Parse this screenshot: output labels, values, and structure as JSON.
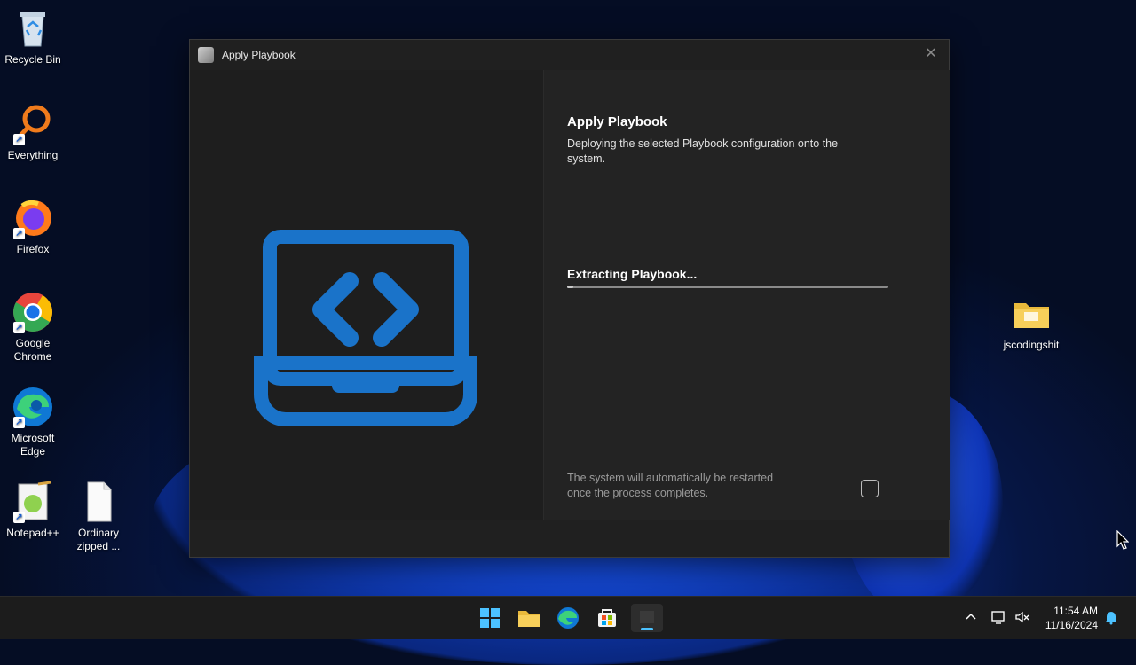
{
  "window": {
    "title": "Apply Playbook",
    "close_icon": "close-icon",
    "heading": "Apply Playbook",
    "description": "Deploying the selected Playbook configuration onto the system.",
    "status": "Extracting Playbook...",
    "progress": 0.02,
    "restart_note": "The system will automatically be restarted once the process completes.",
    "restart_checked": false,
    "accent": "#1a73c9"
  },
  "desktop": {
    "icons": [
      {
        "label": "Recycle Bin"
      },
      {
        "label": "Everything"
      },
      {
        "label": "Firefox"
      },
      {
        "label": "Google Chrome"
      },
      {
        "label": "Microsoft Edge"
      },
      {
        "label": "Notepad++"
      },
      {
        "label": "Ordinary zipped ..."
      },
      {
        "label": "jscodingshit"
      }
    ]
  },
  "taskbar": {
    "time": "11:54 AM",
    "date": "11/16/2024"
  }
}
